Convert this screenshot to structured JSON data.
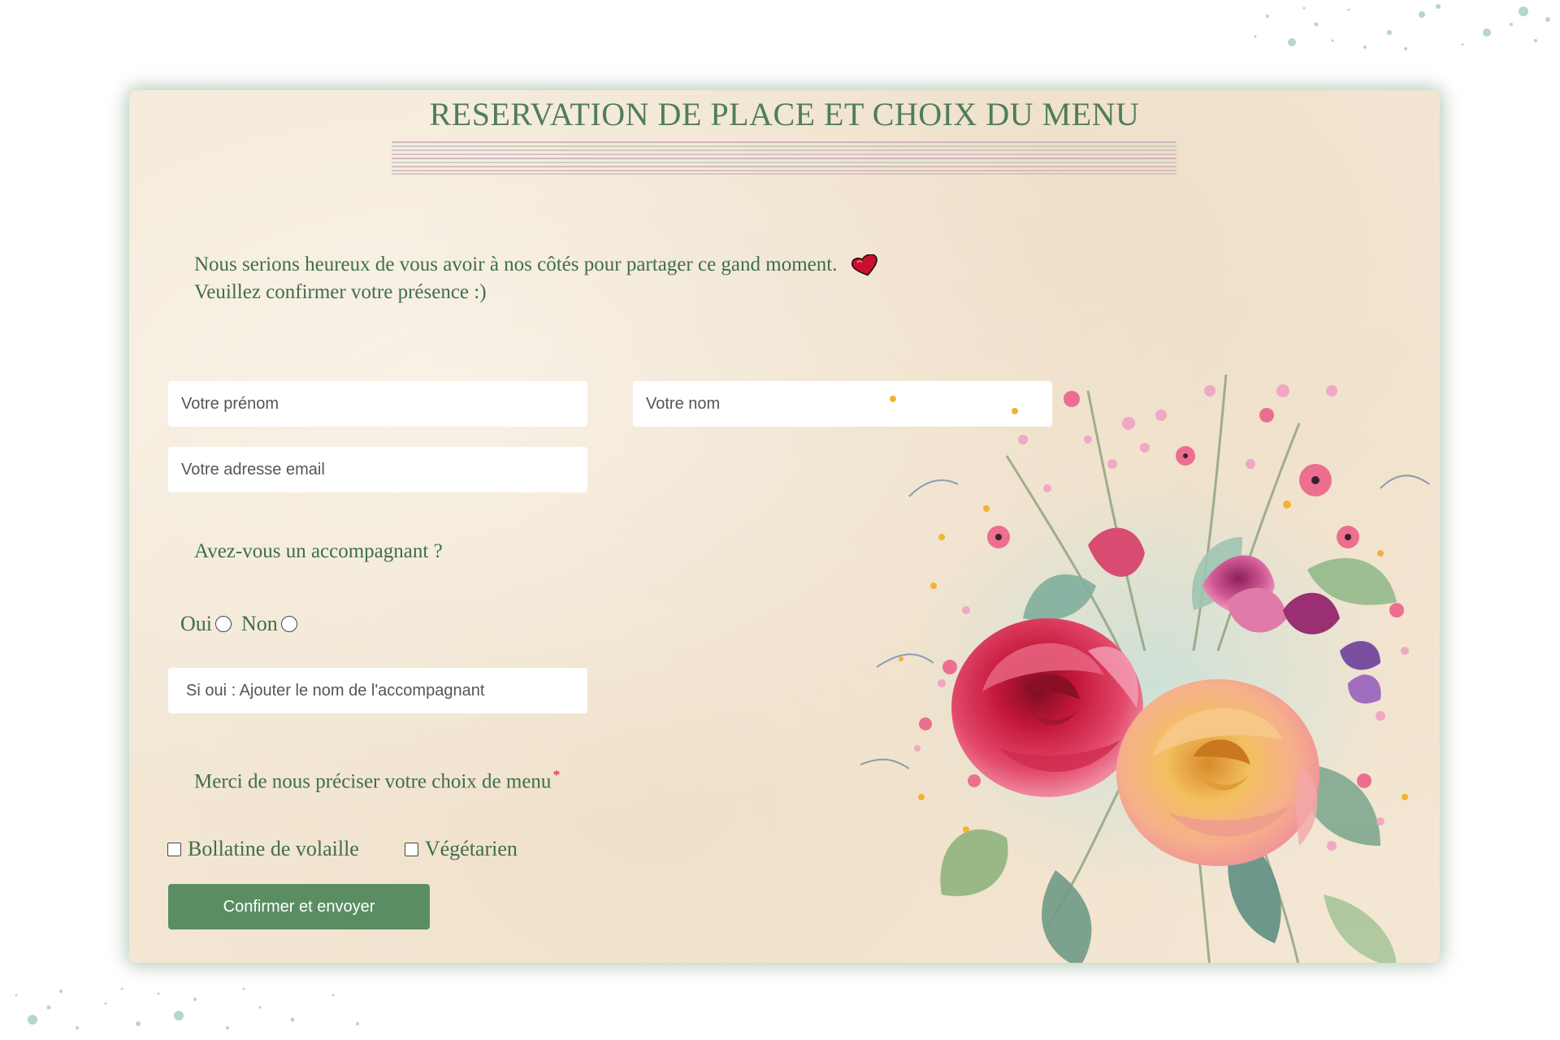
{
  "form": {
    "title": "RESERVATION DE PLACE ET CHOIX DU MENU",
    "intro_line1": "Nous serions heureux de vous avoir à nos côtés pour partager ce gand moment.",
    "intro_line2": "Veuillez confirmer votre présence :)",
    "intro_icon": "heart-icon",
    "first_name_placeholder": "Votre prénom",
    "last_name_placeholder": "Votre nom",
    "email_placeholder": "Votre adresse email",
    "companion_question": "Avez-vous un accompagnant ?",
    "yes_label": "Oui",
    "no_label": "Non",
    "companion_placeholder": "Si oui : Ajouter le nom de l'accompagnant",
    "menu_question": "Merci de nous préciser votre choix de menu",
    "required_mark": "*",
    "menu_option_1": "Bollatine de volaille",
    "menu_option_2": "Végétarien",
    "submit_label": "Confirmer et envoyer"
  },
  "colors": {
    "accent_green": "#5b8d62",
    "text_green": "#3f6e4b",
    "parchment": "#f4e9d7",
    "heart": "#c8102e"
  }
}
